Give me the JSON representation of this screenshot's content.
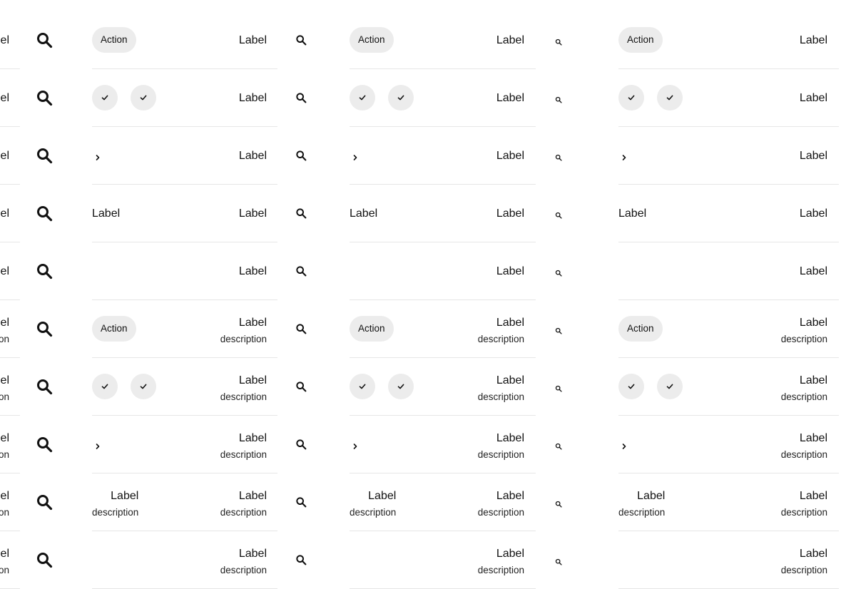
{
  "rows": [
    {
      "type": "action",
      "left_text": "Action",
      "label": "Label",
      "description": "",
      "left_description": ""
    },
    {
      "type": "checks",
      "left_text": "",
      "label": "Label",
      "description": "",
      "left_description": ""
    },
    {
      "type": "chevron",
      "left_text": "",
      "label": "Label",
      "description": "",
      "left_description": ""
    },
    {
      "type": "text",
      "left_text": "Label",
      "label": "Label",
      "description": "",
      "left_description": ""
    },
    {
      "type": "empty",
      "left_text": "",
      "label": "Label",
      "description": "",
      "left_description": ""
    },
    {
      "type": "action",
      "left_text": "Action",
      "label": "Label",
      "description": "description",
      "left_description": ""
    },
    {
      "type": "checks",
      "left_text": "",
      "label": "Label",
      "description": "description",
      "left_description": ""
    },
    {
      "type": "chevron",
      "left_text": "",
      "label": "Label",
      "description": "description",
      "left_description": ""
    },
    {
      "type": "text2",
      "left_text": "Label",
      "label": "Label",
      "description": "description",
      "left_description": "description"
    },
    {
      "type": "empty",
      "left_text": "",
      "label": "Label",
      "description": "description",
      "left_description": ""
    }
  ],
  "partial_column": {
    "label_fragment": "el",
    "description_fragment": "on"
  },
  "icons": {
    "search": "search-icon",
    "check": "check-icon",
    "chevron": "chevron-right-icon"
  },
  "colors": {
    "chip_bg": "#ececec",
    "divider": "#e6e6e6",
    "text": "#111111"
  }
}
